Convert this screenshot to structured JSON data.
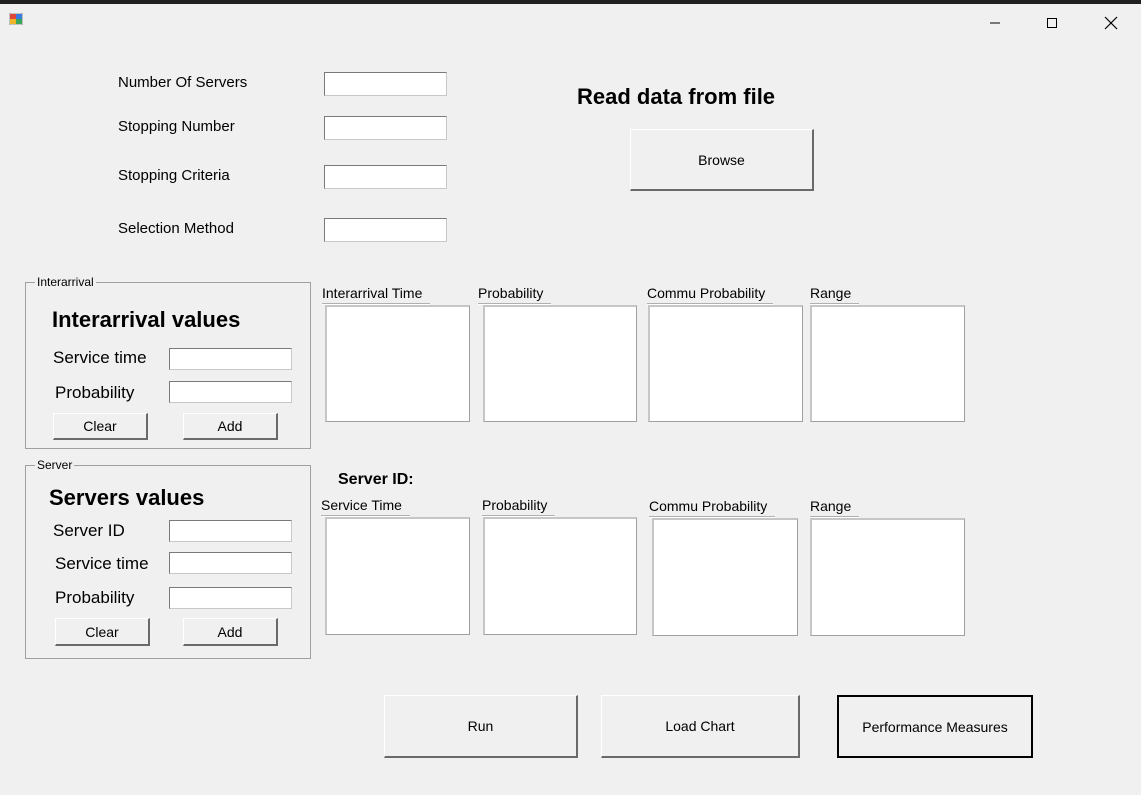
{
  "window": {
    "icon": "winforms-app-icon",
    "controls": {
      "minimize": "—",
      "maximize": "☐",
      "close": "✕"
    }
  },
  "settings": {
    "number_of_servers_label": "Number Of Servers",
    "stopping_number_label": "Stopping Number",
    "stopping_criteria_label": "Stopping Criteria",
    "selection_method_label": "Selection Method",
    "number_of_servers_value": "",
    "stopping_number_value": "",
    "stopping_criteria_value": "",
    "selection_method_value": ""
  },
  "file": {
    "heading": "Read data from file",
    "browse_label": "Browse"
  },
  "interarrival_group": {
    "legend": "Interarrival",
    "heading": "Interarrival values",
    "service_time_label": "Service time",
    "probability_label": "Probability",
    "service_time_value": "",
    "probability_value": "",
    "clear_label": "Clear",
    "add_label": "Add"
  },
  "server_group": {
    "legend": "Server",
    "heading": "Servers values",
    "server_id_label": "Server ID",
    "service_time_label": "Service time",
    "probability_label": "Probability",
    "server_id_value": "",
    "service_time_value": "",
    "probability_value": "",
    "clear_label": "Clear",
    "add_label": "Add"
  },
  "interarrival_table": {
    "columns": [
      "Interarrival Time",
      "Probability",
      "Commu Probability",
      "Range"
    ]
  },
  "server_table": {
    "server_id_label": "Server ID:",
    "columns": [
      "Service Time",
      "Probability",
      "Commu Probability",
      "Range"
    ]
  },
  "actions": {
    "run_label": "Run",
    "load_chart_label": "Load Chart",
    "performance_label": "Performance Measures"
  }
}
